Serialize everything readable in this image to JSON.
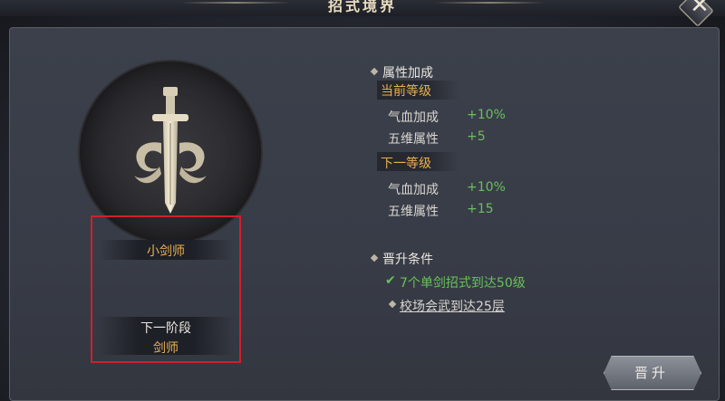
{
  "window": {
    "title": "招式境界",
    "close_label": "✕"
  },
  "rank": {
    "current": "小剑师",
    "next_stage_label": "下一阶段",
    "next": "剑师"
  },
  "attributes": {
    "header": "属性加成",
    "current_level": {
      "label": "当前等级",
      "stats": [
        {
          "name": "气血加成",
          "value": "+10%"
        },
        {
          "name": "五维属性",
          "value": "+5"
        }
      ]
    },
    "next_level": {
      "label": "下一等级",
      "stats": [
        {
          "name": "气血加成",
          "value": "+10%"
        },
        {
          "name": "五维属性",
          "value": "+15"
        }
      ]
    }
  },
  "promotion": {
    "header": "晋升条件",
    "conditions": [
      {
        "text": "7个单剑招式到达50级",
        "done": true
      },
      {
        "text": "校场会武到达25层",
        "done": false
      }
    ],
    "button_label": "晋升"
  },
  "colors": {
    "accent_gold": "#e9b050",
    "done_green": "#67c15b",
    "highlight_red": "#d21f2a"
  },
  "icons": {
    "emblem": "sword-emblem-icon",
    "check": "check-icon",
    "bullet": "diamond-bullet-icon"
  }
}
